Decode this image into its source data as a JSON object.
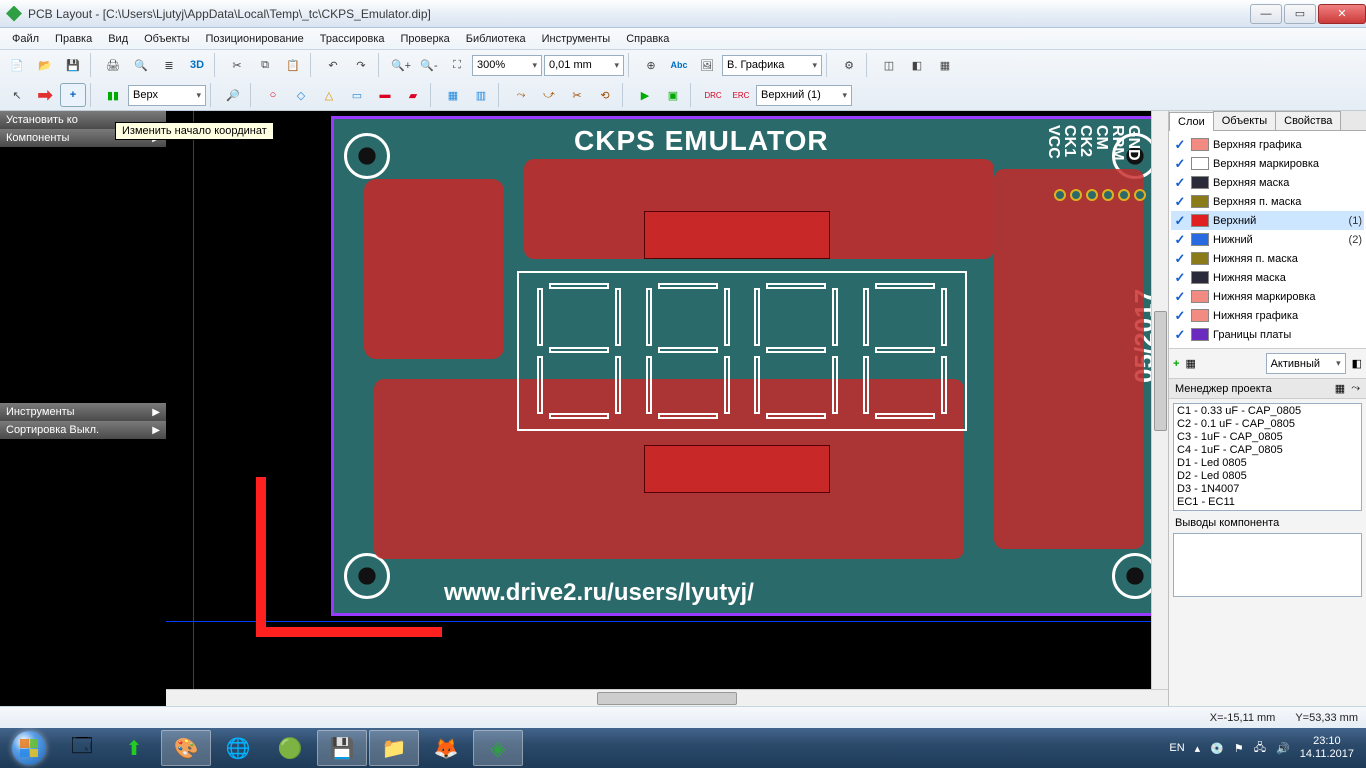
{
  "window": {
    "title": "PCB Layout - [C:\\Users\\Ljutyj\\AppData\\Local\\Temp\\_tc\\CKPS_Emulator.dip]"
  },
  "menu": {
    "file": "Файл",
    "edit": "Правка",
    "view": "Вид",
    "objects": "Объекты",
    "positioning": "Позиционирование",
    "routing": "Трассировка",
    "check": "Проверка",
    "library": "Библиотека",
    "tools": "Инструменты",
    "help": "Справка"
  },
  "toolbar": {
    "zoom": "300%",
    "units": "0,01 mm",
    "render_mode": "В. Графика",
    "layer_combo1": "Верх",
    "layer_combo2": "Верхний (1)",
    "threed": "3D"
  },
  "left": {
    "set_origin": "Установить ко",
    "tooltip": "Изменить начало координат",
    "components": "Компоненты",
    "instruments": "Инструменты",
    "sort": "Сортировка Выкл."
  },
  "pcb": {
    "title": "CKPS EMULATOR",
    "url": "www.drive2.ru/users/lyutyj/",
    "date": "05/2017",
    "pins": [
      "VCC",
      "CK1",
      "CK2",
      "CM",
      "RPM",
      "GND"
    ]
  },
  "right": {
    "tabs": {
      "layers": "Слои",
      "objects": "Объекты",
      "props": "Свойства"
    },
    "layers": [
      {
        "name": "Верхняя графика",
        "color": "#f28b82",
        "num": ""
      },
      {
        "name": "Верхняя маркировка",
        "color": "#ffffff",
        "num": ""
      },
      {
        "name": "Верхняя маска",
        "color": "#2a2a3a",
        "num": ""
      },
      {
        "name": "Верхняя п. маска",
        "color": "#8a7a1a",
        "num": ""
      },
      {
        "name": "Верхний",
        "color": "#e02020",
        "num": "(1)"
      },
      {
        "name": "Нижний",
        "color": "#2a6ae0",
        "num": "(2)"
      },
      {
        "name": "Нижняя п. маска",
        "color": "#8a7a1a",
        "num": ""
      },
      {
        "name": "Нижняя маска",
        "color": "#2a2a3a",
        "num": ""
      },
      {
        "name": "Нижняя маркировка",
        "color": "#f28b82",
        "num": ""
      },
      {
        "name": "Нижняя графика",
        "color": "#f28b82",
        "num": ""
      },
      {
        "name": "Границы платы",
        "color": "#6a2ac0",
        "num": ""
      }
    ],
    "layer_mode": "Активный",
    "mgr_title": "Менеджер проекта",
    "components": [
      "C1 - 0.33 uF - CAP_0805",
      "C2 - 0.1 uF - CAP_0805",
      "C3 - 1uF - CAP_0805",
      "C4 - 1uF - CAP_0805",
      "D1 - Led 0805",
      "D2 - Led 0805",
      "D3 - 1N4007",
      "EC1 - EC11"
    ],
    "pinout_label": "Выводы компонента"
  },
  "status": {
    "x": "X=-15,11 mm",
    "y": "Y=53,33 mm"
  },
  "taskbar": {
    "lang": "EN",
    "time": "23:10",
    "date": "14.11.2017"
  }
}
